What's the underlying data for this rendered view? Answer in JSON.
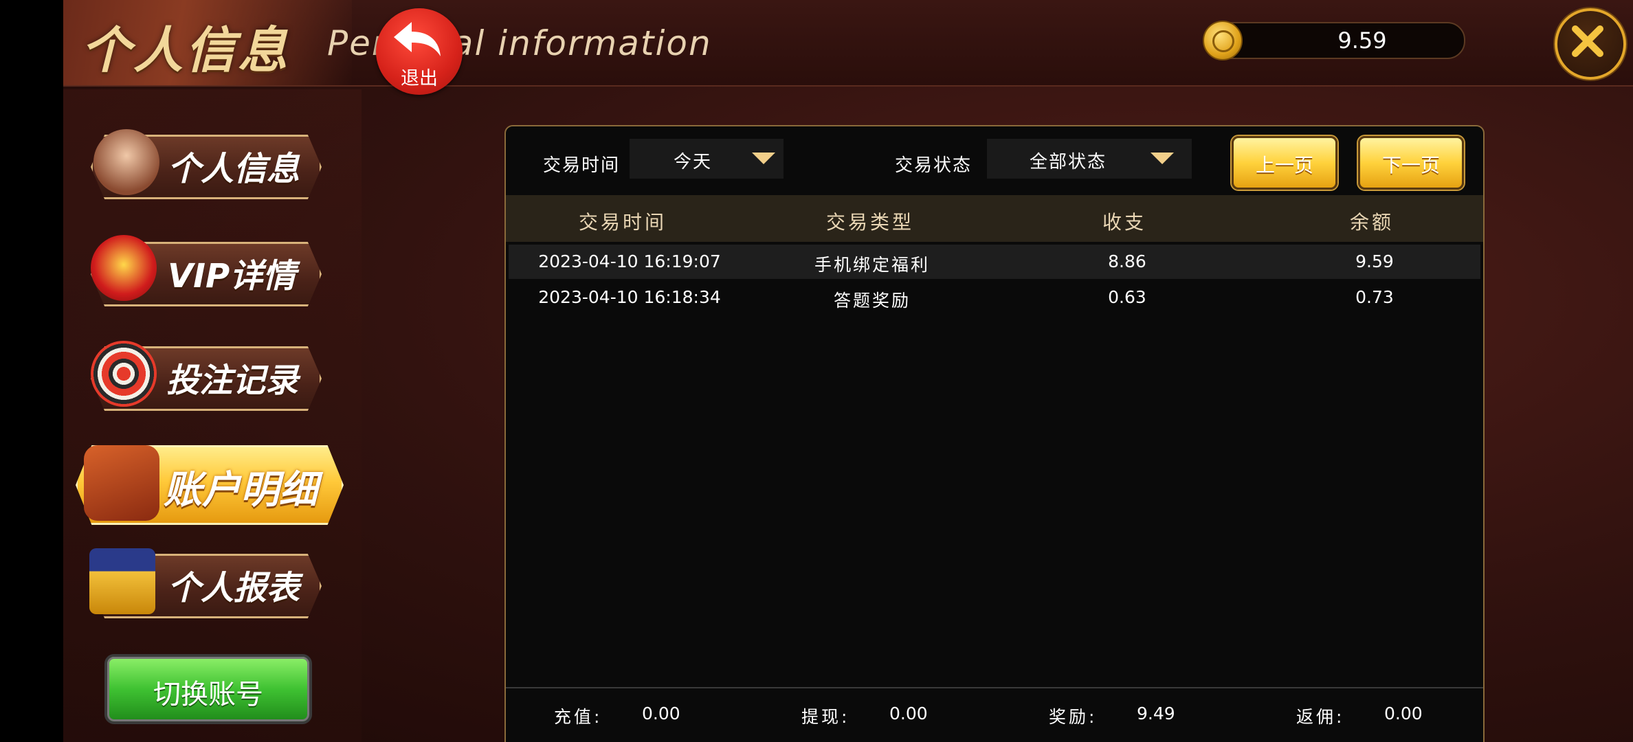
{
  "header": {
    "title_cn": "个人信息",
    "title_en": "Personal information",
    "back_label": "退出",
    "balance": "9.59"
  },
  "sidebar": {
    "items": [
      {
        "label": "个人信息",
        "icon": "lady-avatar-icon"
      },
      {
        "label": "VIP详情",
        "icon": "vip-crown-icon"
      },
      {
        "label": "投注记录",
        "icon": "chips-icon"
      },
      {
        "label": "账户明细",
        "icon": "wallet-icon",
        "active": true
      },
      {
        "label": "个人报表",
        "icon": "coins-flag-icon"
      }
    ],
    "switch_account": "切换账号"
  },
  "filters": {
    "time_label": "交易时间",
    "time_value": "今天",
    "status_label": "交易状态",
    "status_value": "全部状态",
    "prev_page": "上一页",
    "next_page": "下一页"
  },
  "table": {
    "headers": [
      "交易时间",
      "交易类型",
      "收支",
      "余额"
    ],
    "rows": [
      {
        "time": "2023-04-10 16:19:07",
        "type": "手机绑定福利",
        "amount": "8.86",
        "balance": "9.59"
      },
      {
        "time": "2023-04-10 16:18:34",
        "type": "答题奖励",
        "amount": "0.63",
        "balance": "0.73"
      }
    ]
  },
  "summary": {
    "recharge_label": "充值:",
    "recharge_value": "0.00",
    "withdraw_label": "提现:",
    "withdraw_value": "0.00",
    "reward_label": "奖励:",
    "reward_value": "9.49",
    "rebate_label": "返佣:",
    "rebate_value": "0.00"
  },
  "colors": {
    "accent_gold": "#f2cf8a",
    "panel_bg": "#0a0a0a",
    "switch_green": "#3fc232",
    "back_red": "#d6221a"
  }
}
